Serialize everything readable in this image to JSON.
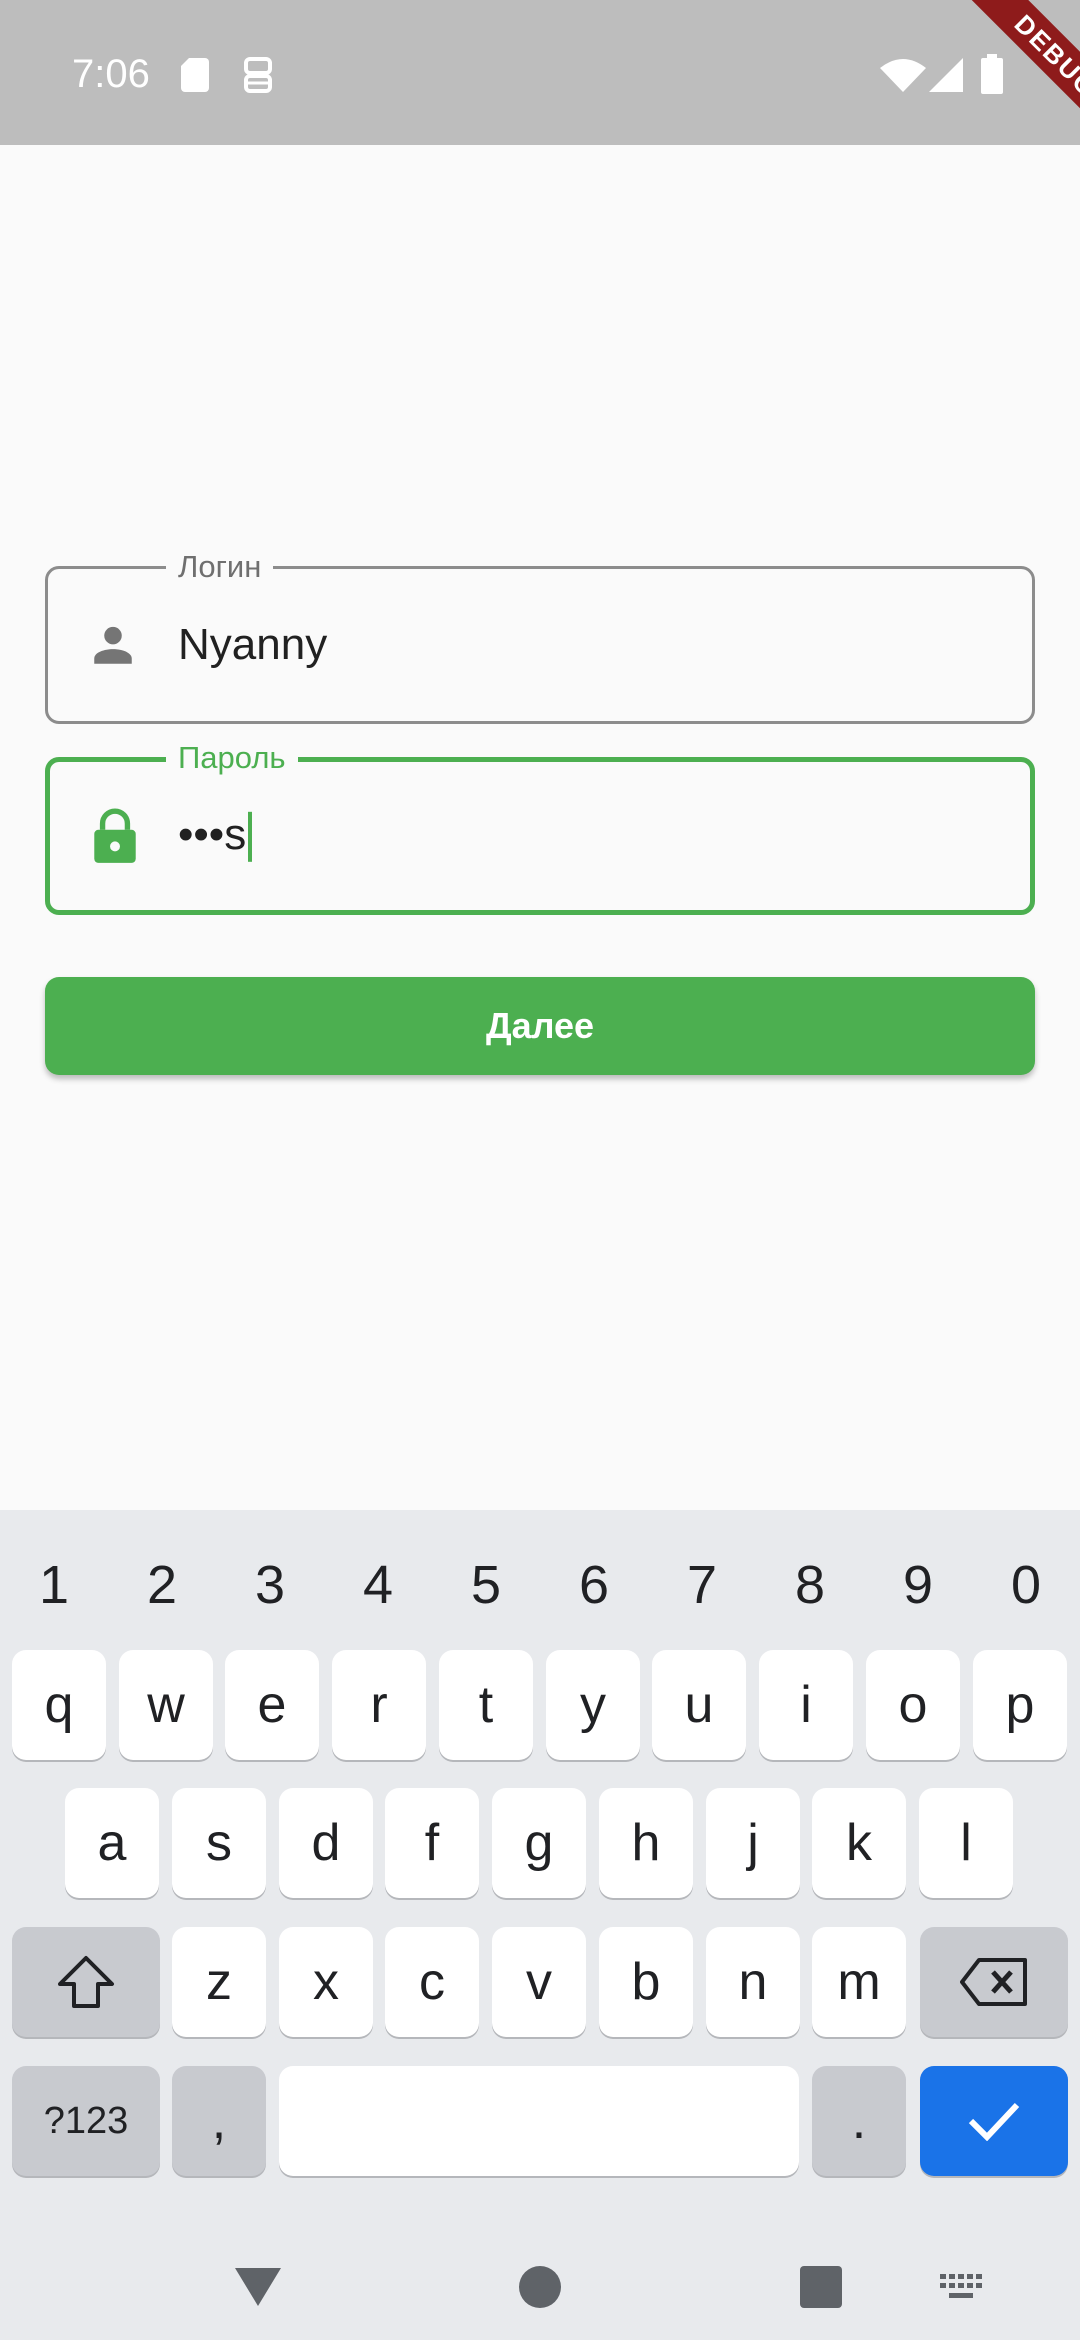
{
  "status_bar": {
    "time": "7:06",
    "left_icons": [
      "sd-card-icon",
      "android-debug-icon"
    ],
    "right_icons": [
      "wifi-icon",
      "cell-signal-icon",
      "battery-icon"
    ],
    "debug_banner": "DEBUG"
  },
  "form": {
    "login": {
      "label": "Логин",
      "value": "Nyanny",
      "icon": "person-icon"
    },
    "password": {
      "label": "Пароль",
      "value": "•••s",
      "icon": "lock-icon"
    },
    "submit_label": "Далее",
    "accent_color": "#4caf50"
  },
  "keyboard": {
    "number_row": [
      "1",
      "2",
      "3",
      "4",
      "5",
      "6",
      "7",
      "8",
      "9",
      "0"
    ],
    "row1": [
      "q",
      "w",
      "e",
      "r",
      "t",
      "y",
      "u",
      "i",
      "o",
      "p"
    ],
    "row2": [
      "a",
      "s",
      "d",
      "f",
      "g",
      "h",
      "j",
      "k",
      "l"
    ],
    "row3": [
      "z",
      "x",
      "c",
      "v",
      "b",
      "n",
      "m"
    ],
    "symbols_label": "?123",
    "comma_label": ",",
    "period_label": ".",
    "action_color": "#1a73e8"
  },
  "nav_bar": {
    "icons": [
      "back-icon",
      "home-icon",
      "recents-icon",
      "keyboard-switch-icon"
    ]
  }
}
